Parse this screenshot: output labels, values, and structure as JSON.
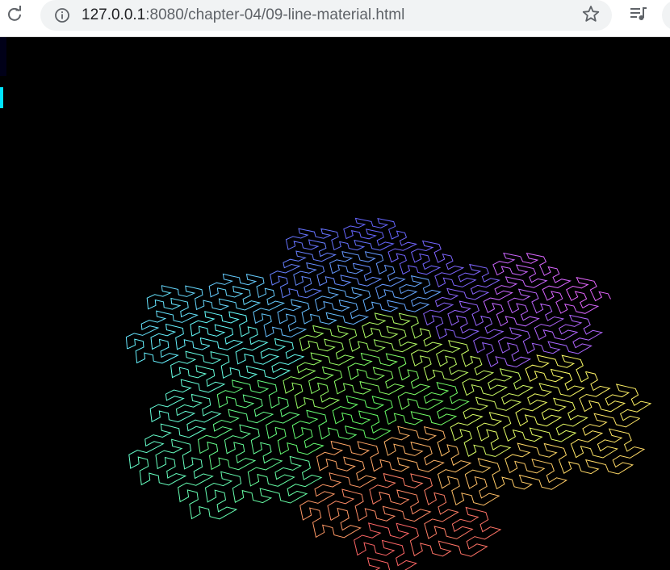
{
  "browser": {
    "url_host": "127.0.0.1",
    "url_rest": ":8080/chapter-04/09-line-material.html",
    "reload_icon": "reload-icon",
    "info_icon": "info-icon",
    "star_icon": "star-icon",
    "media_icon": "media-control-icon"
  },
  "scene": {
    "background": "#000000",
    "curve": "gosper",
    "curve_order": 4,
    "stats_bar_color": "#00e5ff"
  }
}
